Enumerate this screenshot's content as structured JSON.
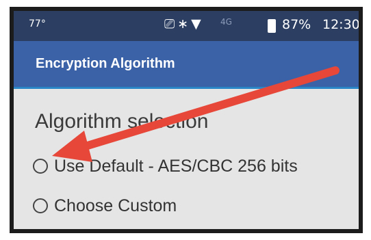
{
  "status_bar": {
    "temperature": "77°",
    "network": "4G",
    "battery": "87%",
    "time": "12:30",
    "icons": [
      "cast-icon",
      "bluetooth-icon",
      "wifi-icon",
      "signal-icon",
      "battery-icon"
    ]
  },
  "appbar": {
    "title": "Encryption Algorithm"
  },
  "preference": {
    "title": "Algorithm selection",
    "options": [
      {
        "label": "Use Default - AES/CBC 256 bits",
        "selected": false
      },
      {
        "label": "Choose Custom",
        "selected": false
      }
    ]
  },
  "colors": {
    "status_bar": "#2c3f62",
    "app_bar": "#3b62a7",
    "accent_line": "#2a86c7",
    "background": "#e5e5e5",
    "annotation_arrow": "#e64738"
  }
}
